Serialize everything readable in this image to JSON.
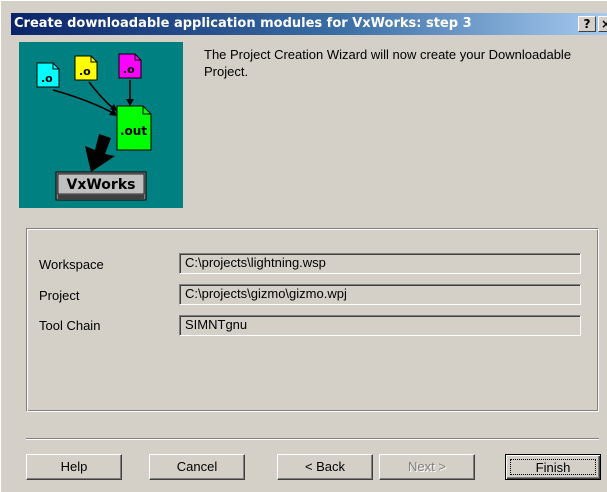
{
  "window": {
    "title": "Create downloadable application modules for VxWorks:  step 3",
    "help_glyph": "?",
    "close_glyph": "×"
  },
  "illustration": {
    "object_label": ".o",
    "output_label": ".out",
    "target_label": "VxWorks",
    "colors": {
      "background": "#008080",
      "object_1": "#00ffff",
      "object_2": "#ffff00",
      "object_3": "#ff00ff",
      "output": "#00ff00"
    }
  },
  "intro": "The Project Creation Wizard will now create your Downloadable Project.",
  "fields": [
    {
      "label": "Workspace",
      "value": "C:\\projects\\lightning.wsp"
    },
    {
      "label": "Project",
      "value": "C:\\projects\\gizmo\\gizmo.wpj"
    },
    {
      "label": "Tool Chain",
      "value": "SIMNTgnu"
    }
  ],
  "buttons": {
    "help": "Help",
    "cancel": "Cancel",
    "back": "< Back",
    "next": "Next >",
    "finish": "Finish"
  }
}
